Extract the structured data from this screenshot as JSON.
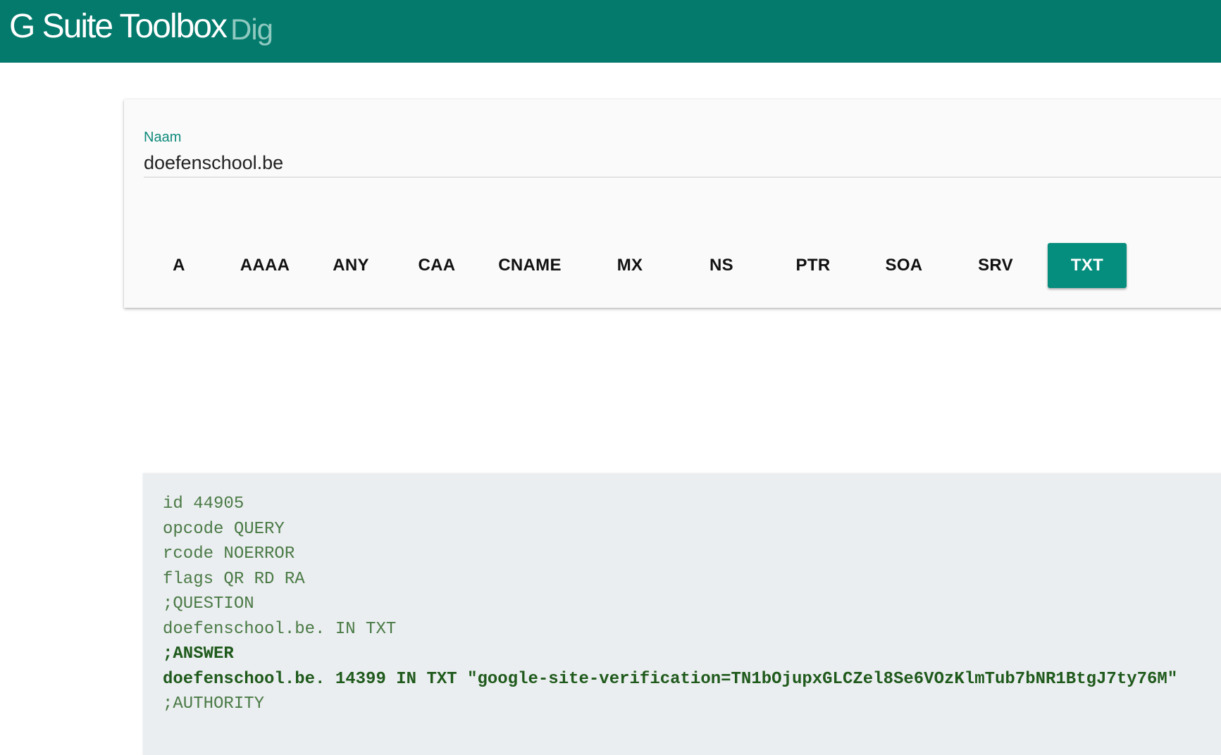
{
  "header": {
    "brand": "G Suite Toolbox",
    "subtitle": "Dig",
    "background_color": "#037a6c"
  },
  "query": {
    "label": "Naam",
    "value": "doefenschool.be"
  },
  "record_types": {
    "items": [
      "A",
      "AAAA",
      "ANY",
      "CAA",
      "CNAME",
      "MX",
      "NS",
      "PTR",
      "SOA",
      "SRV",
      "TXT"
    ],
    "selected": "TXT",
    "active_color": "#058d7d"
  },
  "result": {
    "lines": [
      {
        "text": "id 44905",
        "bold": false
      },
      {
        "text": "opcode QUERY",
        "bold": false
      },
      {
        "text": "rcode NOERROR",
        "bold": false
      },
      {
        "text": "flags QR RD RA",
        "bold": false
      },
      {
        "text": ";QUESTION",
        "bold": false
      },
      {
        "text": "doefenschool.be. IN TXT",
        "bold": false
      },
      {
        "text": ";ANSWER",
        "bold": true
      },
      {
        "text": "doefenschool.be. 14399 IN TXT \"google-site-verification=TN1bOjupxGLCZel8Se6VOzKlmTub7bNR1BtgJ7ty76M\"",
        "bold": true
      },
      {
        "text": ";AUTHORITY",
        "bold": false
      }
    ]
  }
}
